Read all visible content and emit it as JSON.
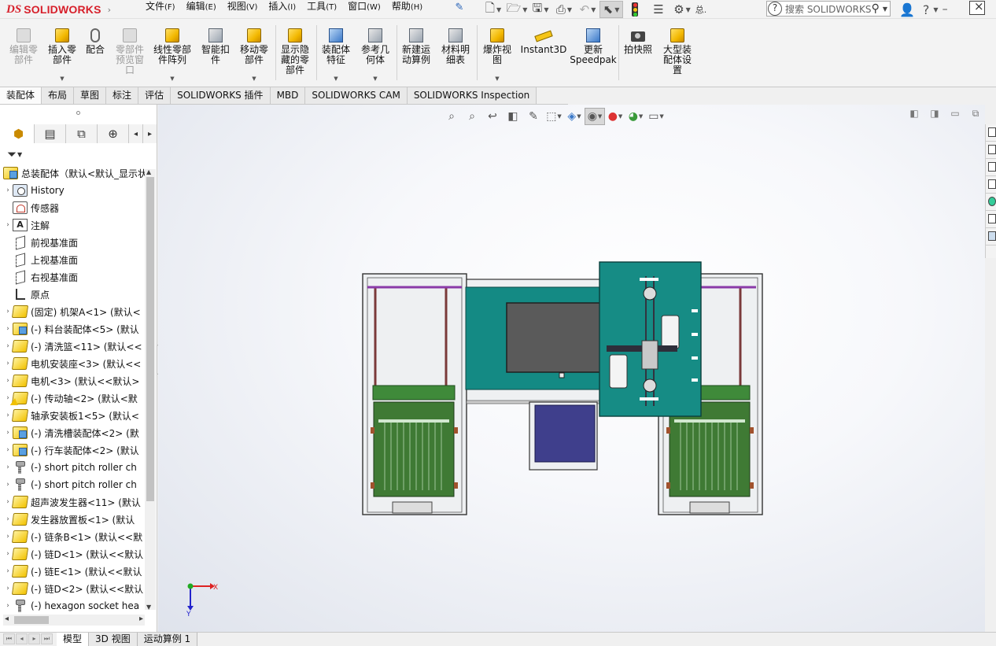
{
  "app": {
    "brand": "SOLIDWORKS",
    "brand_prefix": "DS"
  },
  "menu": [
    {
      "label": "文件",
      "key": "(F)"
    },
    {
      "label": "编辑",
      "key": "(E)"
    },
    {
      "label": "视图",
      "key": "(V)"
    },
    {
      "label": "插入",
      "key": "(I)"
    },
    {
      "label": "工具",
      "key": "(T)"
    },
    {
      "label": "窗口",
      "key": "(W)"
    },
    {
      "label": "帮助",
      "key": "(H)"
    }
  ],
  "search": {
    "placeholder": "搜索 SOLIDWORKS"
  },
  "ribbon": [
    {
      "label": "编辑零\n部件",
      "icon": "edit-component-icon",
      "disabled": true
    },
    {
      "label": "插入零\n部件",
      "icon": "insert-component-icon"
    },
    {
      "label": "配合",
      "icon": "mate-icon"
    },
    {
      "label": "零部件\n预览窗\n口",
      "icon": "component-preview-icon",
      "disabled": true
    },
    {
      "label": "线性零部\n件阵列",
      "icon": "linear-pattern-icon"
    },
    {
      "label": "智能扣\n件",
      "icon": "smart-fasteners-icon"
    },
    {
      "label": "移动零\n部件",
      "icon": "move-component-icon"
    },
    {
      "label": "显示隐\n藏的零\n部件",
      "icon": "show-hidden-icon"
    },
    {
      "label": "装配体\n特征",
      "icon": "assembly-features-icon"
    },
    {
      "label": "参考几\n何体",
      "icon": "reference-geometry-icon"
    },
    {
      "label": "新建运\n动算例",
      "icon": "new-motion-study-icon"
    },
    {
      "label": "材料明\n细表",
      "icon": "bom-icon"
    },
    {
      "label": "爆炸视\n图",
      "icon": "exploded-view-icon"
    },
    {
      "label": "Instant3D",
      "icon": "instant3d-icon"
    },
    {
      "label": "更新\nSpeedpak",
      "icon": "speedpak-icon"
    },
    {
      "label": "拍快照",
      "icon": "snapshot-icon"
    },
    {
      "label": "大型装\n配体设\n置",
      "icon": "large-assembly-icon"
    }
  ],
  "tabs": [
    "装配体",
    "布局",
    "草图",
    "标注",
    "评估",
    "SOLIDWORKS 插件",
    "MBD",
    "SOLIDWORKS CAM",
    "SOLIDWORKS Inspection"
  ],
  "tree": {
    "root": "总装配体（默认<默认_显示状",
    "items": [
      {
        "label": "History",
        "icon": "history"
      },
      {
        "label": "传感器",
        "icon": "sensor"
      },
      {
        "label": "注解",
        "icon": "annotation"
      },
      {
        "label": "前视基准面",
        "icon": "plane"
      },
      {
        "label": "上视基准面",
        "icon": "plane"
      },
      {
        "label": "右视基准面",
        "icon": "plane"
      },
      {
        "label": "原点",
        "icon": "origin"
      },
      {
        "label": "(固定) 机架A<1> (默认<",
        "icon": "part"
      },
      {
        "label": "(-) 料台装配体<5> (默认",
        "icon": "assembly"
      },
      {
        "label": "(-) 清洗篮<11> (默认<<",
        "icon": "part"
      },
      {
        "label": "电机安装座<3> (默认<<",
        "icon": "part"
      },
      {
        "label": "电机<3> (默认<<默认>",
        "icon": "part"
      },
      {
        "label": "(-) 传动轴<2> (默认<默",
        "icon": "part-warn"
      },
      {
        "label": "轴承安装板1<5> (默认<",
        "icon": "part"
      },
      {
        "label": "(-) 清洗槽装配体<2> (默",
        "icon": "assembly"
      },
      {
        "label": "(-) 行车装配体<2> (默认",
        "icon": "assembly"
      },
      {
        "label": "(-) short pitch roller ch",
        "icon": "bolt"
      },
      {
        "label": "(-) short pitch roller ch",
        "icon": "bolt"
      },
      {
        "label": "超声波发生器<11> (默认",
        "icon": "part"
      },
      {
        "label": "发生器放置板<1> (默认",
        "icon": "part"
      },
      {
        "label": "(-) 链条B<1> (默认<<默",
        "icon": "part"
      },
      {
        "label": "(-) 链D<1> (默认<<默认",
        "icon": "part"
      },
      {
        "label": "(-) 链E<1> (默认<<默认",
        "icon": "part"
      },
      {
        "label": "(-) 链D<2> (默认<<默认",
        "icon": "part"
      },
      {
        "label": "(-) hexagon socket hea",
        "icon": "bolt"
      }
    ]
  },
  "triad": {
    "x": "X",
    "y": "Y"
  },
  "bottom_tabs": [
    "模型",
    "3D 视图",
    "运动算例 1"
  ]
}
